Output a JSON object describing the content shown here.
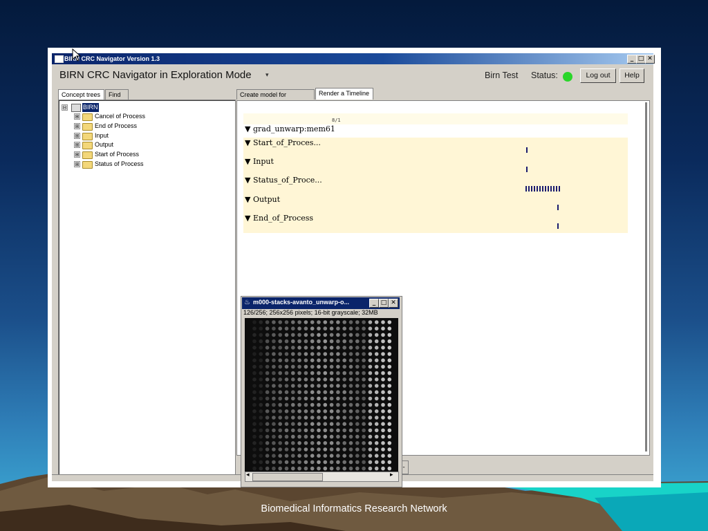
{
  "window": {
    "title": "BIRN CRC Navigator Version 1.3",
    "minimize": "_",
    "maximize": "□",
    "close": "✕"
  },
  "header": {
    "heading_prefix": "BIRN CRC Navigator in  Exploration Mode",
    "mode_caret": "▾",
    "user": "Birn Test",
    "status_label": "Status:",
    "status_color": "#2ad62a",
    "logout": "Log out",
    "help": "Help"
  },
  "left_tabs": [
    {
      "label": "Concept trees",
      "active": true
    },
    {
      "label": "Find",
      "active": false
    }
  ],
  "tree": {
    "root": "BIRN",
    "root_expander": "⊟",
    "items": [
      {
        "expander": "⊞",
        "label": "Cancel of Process"
      },
      {
        "expander": "⊞",
        "label": "End of Process"
      },
      {
        "expander": "⊞",
        "label": "Input"
      },
      {
        "expander": "⊞",
        "label": "Output"
      },
      {
        "expander": "⊞",
        "label": "Start of Process"
      },
      {
        "expander": "⊞",
        "label": "Status of Process"
      }
    ]
  },
  "right_tabs": [
    {
      "label": "Create model for Timeline",
      "active": false
    },
    {
      "label": "Render a Timeline",
      "active": true
    }
  ],
  "timeline": {
    "scale_label": "8/1",
    "rows": [
      {
        "label": "▼ grad_unwarp:mem61"
      },
      {
        "label": "▼ Start_of_Proces..."
      },
      {
        "label": "▼ Input"
      },
      {
        "label": "▼ Status_of_Proce..."
      },
      {
        "label": "▼ Output"
      },
      {
        "label": "▼ End_of_Process"
      }
    ],
    "mark_color": "#1a1a6e"
  },
  "image_window": {
    "title": "m000-stacks-avanto_unwarp-o...",
    "info": "126/256; 256x256 pixels; 16-bit grayscale; 32MB",
    "icon": "♨",
    "minimize": "_",
    "maximize": "□",
    "close": "✕",
    "scroll_left": "◂",
    "scroll_right": "▸"
  },
  "partial_button": "-",
  "footer": {
    "text": "Biomedical Informatics Research Network"
  }
}
